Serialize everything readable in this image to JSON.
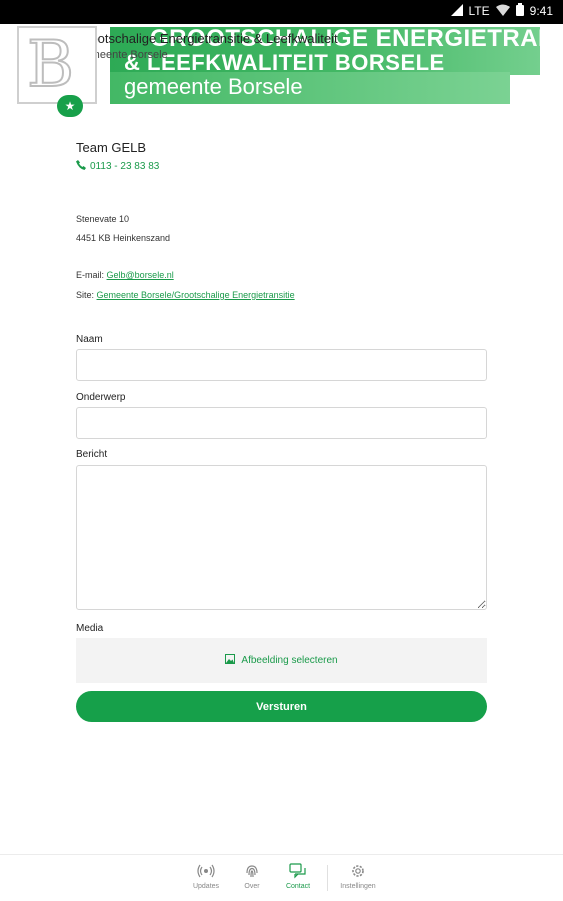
{
  "status_bar": {
    "network": "LTE",
    "time": "9:41"
  },
  "header": {
    "banner_line1": "GROOTSCHALIGE ENERGIETRANSITIE",
    "banner_line2": "& LEEFKWALITEIT BORSELE",
    "banner_line3": "gemeente Borsele",
    "app_title": "Grootschalige Energietransitie & Leefkwaliteit",
    "app_subtitle": "Gemeente Borsele",
    "logo_letter": "B"
  },
  "contact": {
    "team": "Team GELB",
    "phone": "0113 - 23 83 83",
    "address_line1": "Stenevate 10",
    "address_line2": "4451 KB Heinkenszand",
    "email_label": "E-mail:",
    "email": "Gelb@borsele.nl",
    "site_label": "Site:",
    "site_link": "Gemeente Borsele/Grootschalige Energietransitie"
  },
  "form": {
    "naam_label": "Naam",
    "naam_value": "",
    "onderwerp_label": "Onderwerp",
    "onderwerp_value": "",
    "bericht_label": "Bericht",
    "bericht_value": "",
    "media_label": "Media",
    "media_button": "Afbeelding selecteren",
    "submit": "Versturen"
  },
  "bottom_nav": {
    "items": [
      {
        "label": "Updates",
        "icon": "broadcast-icon"
      },
      {
        "label": "Over",
        "icon": "fingerprint-icon"
      },
      {
        "label": "Contact",
        "icon": "chat-icon",
        "active": true
      },
      {
        "label": "Instellingen",
        "icon": "gear-icon"
      }
    ]
  },
  "colors": {
    "accent": "#16a04a",
    "banner": "#43b865"
  }
}
